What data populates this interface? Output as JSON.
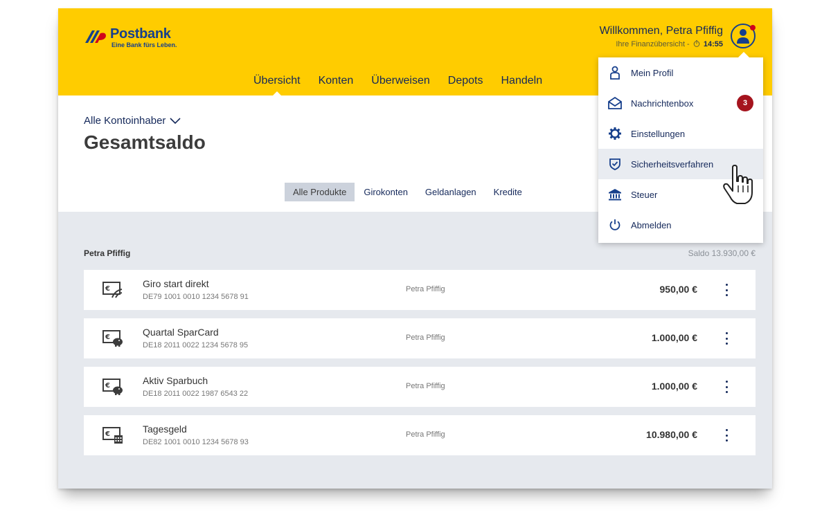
{
  "brand": {
    "name": "Postbank",
    "slogan": "Eine Bank fürs Leben.",
    "colors": {
      "primary_yellow": "#ffcc00",
      "primary_blue": "#163f8c",
      "badge_red": "#a5141e"
    }
  },
  "header": {
    "welcome": "Willkommen, Petra Pfiffig",
    "subtitle": "Ihre Finanzübersicht -",
    "session_time": "14:55"
  },
  "nav": {
    "items": [
      {
        "label": "Übersicht",
        "active": true
      },
      {
        "label": "Konten"
      },
      {
        "label": "Überweisen"
      },
      {
        "label": "Depots"
      },
      {
        "label": "Handeln"
      }
    ]
  },
  "main": {
    "holder_select": "Alle Kontoinhaber",
    "title": "Gesamtsaldo",
    "filters": [
      {
        "label": "Alle Produkte",
        "active": true
      },
      {
        "label": "Girokonten"
      },
      {
        "label": "Geldanlagen"
      },
      {
        "label": "Kredite"
      }
    ]
  },
  "group": {
    "name": "Petra Pfiffig",
    "saldo": "Saldo 13.930,00 €"
  },
  "accounts": [
    {
      "name": "Giro start direkt",
      "iban": "DE79 1001 0010 1234 5678 91",
      "owner": "Petra Pfiffig",
      "amount": "950,00 €",
      "icon": "giro-card-icon"
    },
    {
      "name": "Quartal SparCard",
      "iban": "DE18 2011 0022 1234 5678 95",
      "owner": "Petra Pfiffig",
      "amount": "1.000,00 €",
      "icon": "savings-piggy-icon"
    },
    {
      "name": "Aktiv Sparbuch",
      "iban": "DE18 2011 0022 1987 6543 22",
      "owner": "Petra Pfiffig",
      "amount": "1.000,00 €",
      "icon": "savings-piggy-icon"
    },
    {
      "name": "Tagesgeld",
      "iban": "DE82 1001 0010 1234 5678 93",
      "owner": "Petra Pfiffig",
      "amount": "10.980,00 €",
      "icon": "calendar-money-icon"
    }
  ],
  "user_menu": {
    "items": [
      {
        "label": "Mein Profil",
        "icon": "person-icon"
      },
      {
        "label": "Nachrichtenbox",
        "icon": "envelope-icon",
        "badge": "3"
      },
      {
        "label": "Einstellungen",
        "icon": "gear-icon"
      },
      {
        "label": "Sicherheitsverfahren",
        "icon": "shield-check-icon",
        "hover": true
      },
      {
        "label": "Steuer",
        "icon": "bank-building-icon"
      },
      {
        "label": "Abmelden",
        "icon": "power-icon"
      }
    ]
  }
}
